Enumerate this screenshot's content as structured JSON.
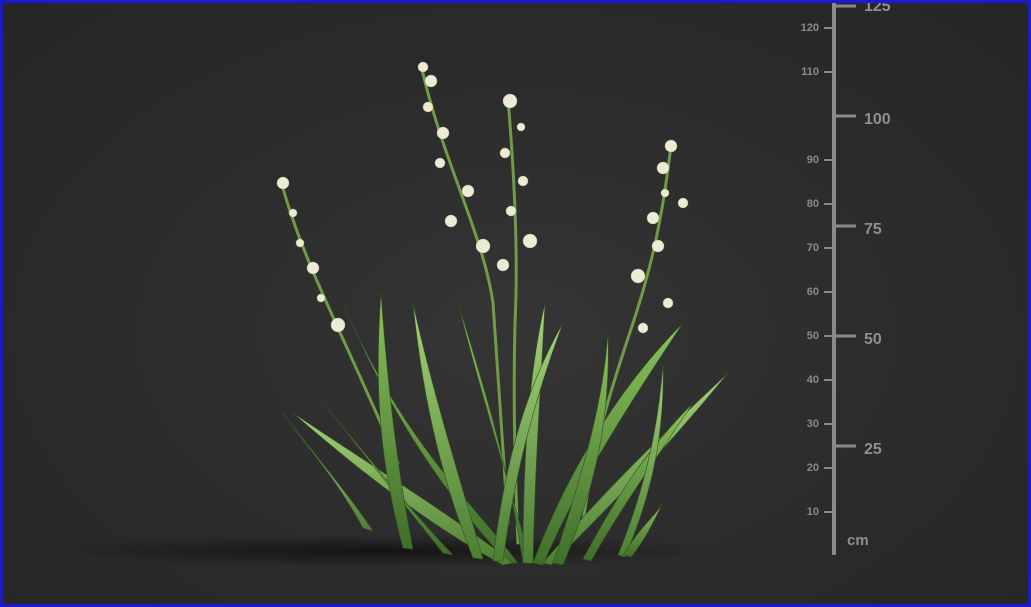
{
  "scale": {
    "unit": "cm",
    "minor_ticks": [
      "10",
      "20",
      "30",
      "40",
      "50",
      "60",
      "70",
      "80",
      "90",
      "110",
      "120"
    ],
    "major_ticks": [
      "25",
      "50",
      "75",
      "100",
      "125"
    ]
  },
  "colors": {
    "background": "#2b2b2b",
    "frame": "#1a1ad0",
    "ruler": "#8a8a8a",
    "leaf": "#6fa64a",
    "flower": "#ecebd6"
  }
}
